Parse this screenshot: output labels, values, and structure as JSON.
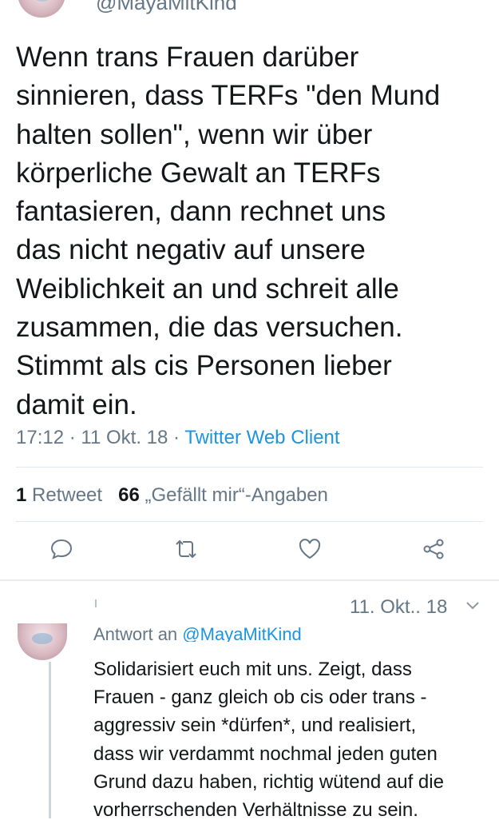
{
  "main_tweet": {
    "handle": "@MayaMitKind",
    "text": "Wenn trans Frauen darüber\nsinnieren, dass TERFs \"den Mund\nhalten sollen\", wenn wir über\nkörperliche Gewalt an TERFs\nfantasieren, dann rechnet uns\ndas nicht negativ auf unsere\nWeiblichkeit an und schreit alle\nzusammen, die das versuchen.\nStimmt als cis Personen lieber\ndamit ein.",
    "time": "17:12",
    "date": "11 Okt. 18",
    "separator": "·",
    "client": "Twitter Web Client"
  },
  "stats": {
    "retweets_count": "1",
    "retweets_label": "Retweet",
    "likes_count": "66",
    "likes_label": "„Gefällt mir“-Angaben"
  },
  "actions": {
    "reply_icon": "reply-icon",
    "retweet_icon": "retweet-icon",
    "like_icon": "heart-icon",
    "share_icon": "share-icon"
  },
  "reply_tweet": {
    "date": "11. Okt.. 18",
    "reply_prefix": "Antwort an",
    "reply_mention": "@MayaMitKind",
    "text": "Solidarisiert euch mit uns. Zeigt, dass\nFrauen - ganz gleich ob cis oder trans -\naggressiv sein *dürfen*, und realisiert,\ndass wir verdammt nochmal jeden guten\nGrund dazu haben, richtig wütend auf die\nvorherrschenden Verhältnisse zu sein."
  },
  "colors": {
    "text": "#14171a",
    "secondary": "#657786",
    "link": "#1b95e0",
    "divider": "#e1e8ed"
  }
}
